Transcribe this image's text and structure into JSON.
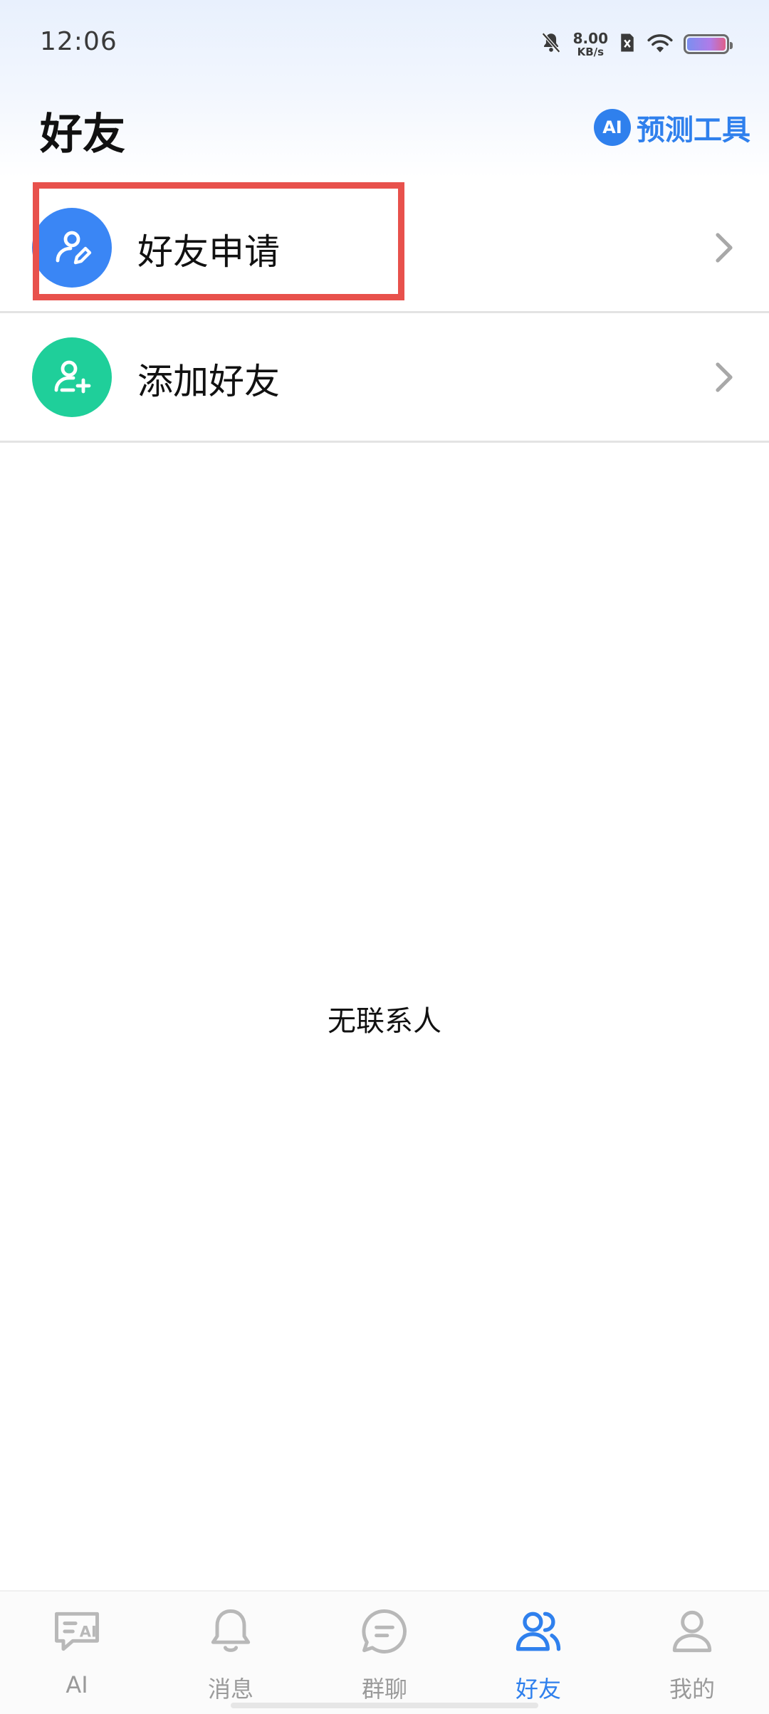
{
  "status_bar": {
    "time": "12:06",
    "net_speed_value": "8.00",
    "net_speed_unit": "KB/s",
    "icons": [
      "bell-muted-icon",
      "sim-blocked-icon",
      "wifi-icon",
      "battery-icon"
    ]
  },
  "header": {
    "title": "好友",
    "ai_badge": "AI",
    "ai_tool_label": "预测工具"
  },
  "list": {
    "items": [
      {
        "label": "好友申请",
        "icon": "user-edit-icon",
        "color": "#3a86f5"
      },
      {
        "label": "添加好友",
        "icon": "user-add-icon",
        "color": "#1fcf9a"
      }
    ]
  },
  "empty_state": {
    "text": "无联系人"
  },
  "bottom_nav": {
    "items": [
      {
        "label": "AI",
        "icon": "ai-chat-icon",
        "active": false
      },
      {
        "label": "消息",
        "icon": "bell-icon",
        "active": false
      },
      {
        "label": "群聊",
        "icon": "chat-bubble-icon",
        "active": false
      },
      {
        "label": "好友",
        "icon": "friends-icon",
        "active": true
      },
      {
        "label": "我的",
        "icon": "profile-icon",
        "active": false
      }
    ]
  },
  "colors": {
    "accent": "#2f80ed",
    "highlight": "#e8514c",
    "inactive": "#9a9a9a"
  }
}
